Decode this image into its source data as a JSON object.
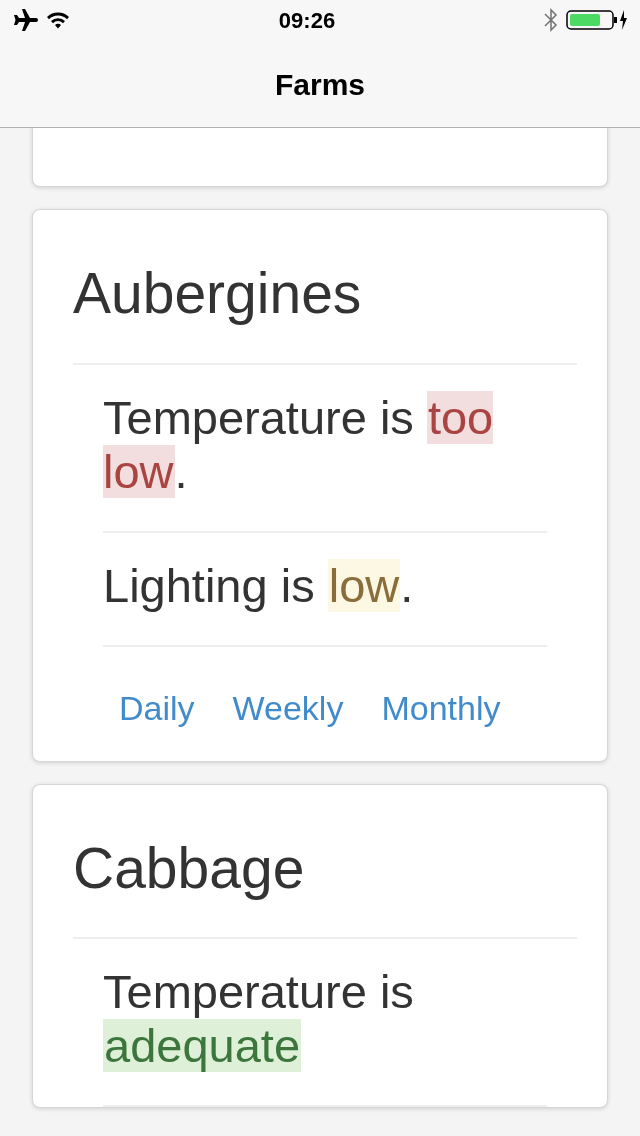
{
  "status_bar": {
    "time": "09:26"
  },
  "nav": {
    "title": "Farms"
  },
  "cards": [
    {
      "kind": "scrolled_off"
    },
    {
      "kind": "farm",
      "title": "Aubergines",
      "items": [
        {
          "prefix": "Temperature is ",
          "value": "too low",
          "suffix": ".",
          "color": "#f2dede"
        },
        {
          "prefix": "Lighting is ",
          "value": "low",
          "suffix": ".",
          "color": "#fcf8e3"
        }
      ],
      "links": [
        "Daily",
        "Weekly",
        "Monthly"
      ]
    },
    {
      "kind": "farm",
      "title": "Cabbage",
      "items": [
        {
          "prefix": "Temperature is ",
          "value": "adequate",
          "color": "#dff0d8"
        }
      ]
    }
  ]
}
